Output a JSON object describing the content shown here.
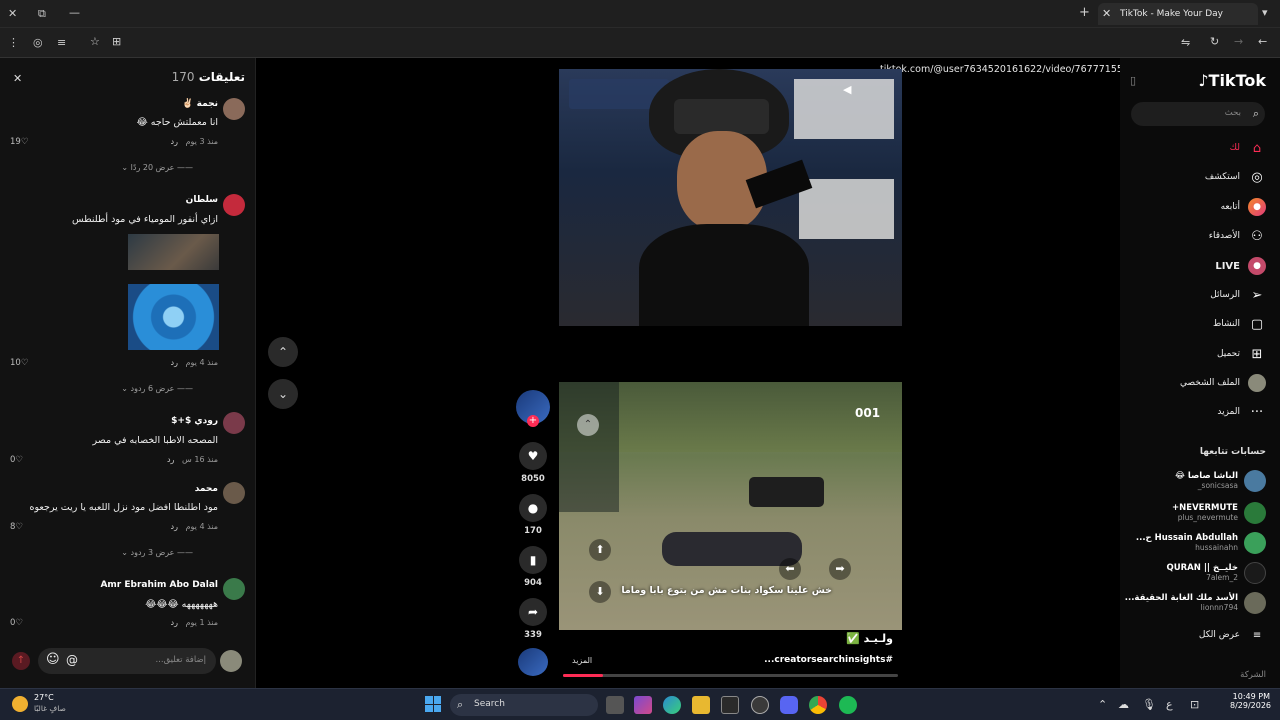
{
  "browser": {
    "tab_title": "TikTok - Make Your Day",
    "url": "tiktok.com/@user7634520161622/video/7677715563958832405"
  },
  "comments_panel": {
    "header_label": "تعليقات",
    "count": "170",
    "items": [
      {
        "name": "نجمة ✌🏻",
        "text": "انا معملتش حاجه 😂",
        "time": "منذ 3 يوم",
        "reply": "رد",
        "likes": "19",
        "view_replies": "عرض 20 ردًا"
      },
      {
        "name": "سلطان",
        "text": "ازاي أنفور المومياء في مود أطلنطس",
        "time": "منذ 4 يوم",
        "reply": "رد",
        "likes": "10",
        "view_replies": "عرض 6 ردود"
      },
      {
        "name": "رودي $+$",
        "text": "المصحه الاطبا الخصابه في مصر",
        "time": "منذ 16 س",
        "reply": "رد",
        "likes": "0"
      },
      {
        "name": "محمد",
        "text": "مود اطلنطا افضل مود نزل اللعبه يا ريت يرجعوه",
        "time": "منذ 4 يوم",
        "reply": "رد",
        "likes": "8",
        "view_replies": "عرض 3 ردود"
      },
      {
        "name": "Amr Ebrahim Abo Dalal",
        "text": "هههههههه 😂😂😂",
        "time": "منذ 1 يوم",
        "reply": "رد",
        "likes": "0"
      }
    ],
    "input_placeholder": "إضافة تعليق..."
  },
  "video": {
    "actions": {
      "likes": "8050",
      "comments": "170",
      "saves": "904",
      "shares": "339"
    },
    "caption_overlay": "خش علينا سكواد بنات مش من بتوع بابا وماما",
    "game_ui_ammo": "001",
    "author_name": "ولـيـد ✅",
    "hashtag": "#creatorsearchinsights...",
    "more_label": "المزيد",
    "progress": 0.12
  },
  "sidebar": {
    "logo": "TikTok",
    "search_placeholder": "بحث",
    "nav": [
      {
        "label": "لك",
        "icon": "home-icon"
      },
      {
        "label": "استكشف",
        "icon": "compass-icon"
      },
      {
        "label": "أتابعه",
        "icon": "following-icon"
      },
      {
        "label": "الأصدقاء",
        "icon": "friends-icon"
      },
      {
        "label": "LIVE",
        "icon": "live-icon"
      },
      {
        "label": "الرسائل",
        "icon": "send-icon"
      },
      {
        "label": "النشاط",
        "icon": "activity-icon"
      },
      {
        "label": "تحميل",
        "icon": "upload-icon"
      },
      {
        "label": "الملف الشخصي",
        "icon": "profile-icon"
      },
      {
        "label": "المزيد",
        "icon": "more-icon"
      }
    ],
    "following_title": "حسابات تتابعها",
    "following": [
      {
        "name": "الباشا صاصا 😂",
        "user": "sonicsasa_"
      },
      {
        "name": "NEVERMUTE+",
        "user": "plus_nevermute"
      },
      {
        "name": "Hussain Abdullah ح...",
        "user": "hussainahn"
      },
      {
        "name": "خليــخ || QURAN",
        "user": "7alem_2"
      },
      {
        "name": "الأسد ملك الغابة الحقيقة...",
        "user": "lionnn794"
      }
    ],
    "see_all": "عرض الكل",
    "company": "الشركة"
  },
  "taskbar": {
    "weather_temp": "27°C",
    "weather_desc": "صافٍ غالبًا",
    "search_label": "Search",
    "time": "10:49 PM",
    "date": "8/29/2026"
  }
}
